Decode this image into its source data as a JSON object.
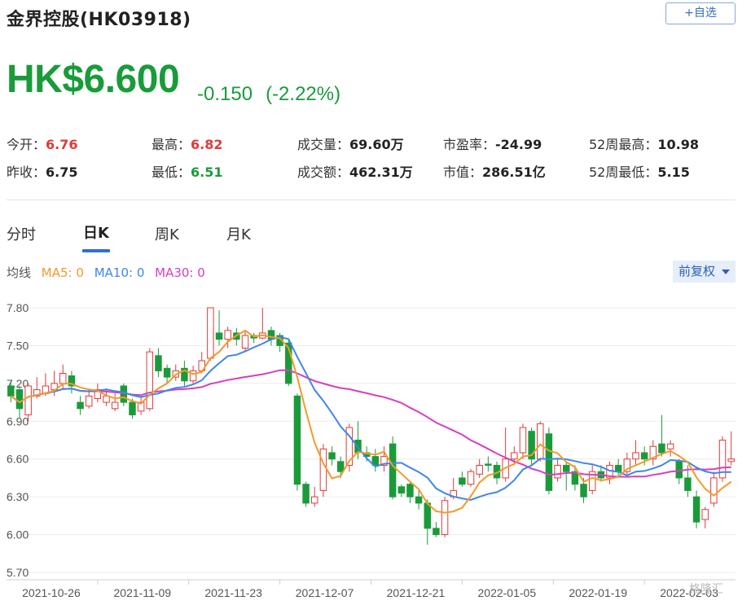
{
  "header": {
    "title": "金界控股(HK03918)",
    "watch_label": "+自选"
  },
  "quote": {
    "price": "HK$6.600",
    "change": "-0.150",
    "change_pct": "(-2.22%)"
  },
  "stats": {
    "open_label": "今开：",
    "open": "6.76",
    "high_label": "最高：",
    "high": "6.82",
    "volume_label": "成交量：",
    "volume": "69.60万",
    "pe_label": "市盈率：",
    "pe": "-24.99",
    "high52_label": "52周最高：",
    "high52": "10.98",
    "prev_label": "昨收：",
    "prev": "6.75",
    "low_label": "最低：",
    "low": "6.51",
    "turnover_label": "成交额：",
    "turnover": "462.31万",
    "mcap_label": "市值：",
    "mcap": "286.51亿",
    "low52_label": "52周最低：",
    "low52": "5.15"
  },
  "tabs": [
    "分时",
    "日K",
    "周K",
    "月K"
  ],
  "legend": {
    "label": "均线",
    "ma5": "MA5: 0",
    "ma10": "MA10: 0",
    "ma30": "MA30: 0"
  },
  "adjust_label": "前复权",
  "watermark": "格隆汇",
  "colors": {
    "up": "#e03a3a",
    "down": "#1a9b3a",
    "ma5": "#f39a2b",
    "ma10": "#3f86e8",
    "ma30": "#d63fbf"
  },
  "icons": [
    "caret-down-icon"
  ],
  "chart_data": {
    "type": "candlestick",
    "ylim": [
      5.7,
      7.8
    ],
    "yticks": [
      "7.80",
      "7.50",
      "7.20",
      "6.90",
      "6.60",
      "6.30",
      "6.00",
      "5.70"
    ],
    "xticks": [
      "2021-10-26",
      "2021-11-09",
      "2021-11-23",
      "2021-12-07",
      "2021-12-21",
      "2022-01-05",
      "2022-01-19",
      "2022-02-03"
    ],
    "candles": [
      [
        7.18,
        7.1,
        7.22,
        7.05
      ],
      [
        7.15,
        7.0,
        7.18,
        6.92
      ],
      [
        6.95,
        7.18,
        7.2,
        6.9
      ],
      [
        7.1,
        7.15,
        7.25,
        7.08
      ],
      [
        7.12,
        7.18,
        7.28,
        7.1
      ],
      [
        7.15,
        7.2,
        7.3,
        7.1
      ],
      [
        7.2,
        7.28,
        7.35,
        7.15
      ],
      [
        7.26,
        7.18,
        7.3,
        7.12
      ],
      [
        7.05,
        7.0,
        7.1,
        6.95
      ],
      [
        7.02,
        7.1,
        7.15,
        7.0
      ],
      [
        7.08,
        7.15,
        7.2,
        7.05
      ],
      [
        7.05,
        7.1,
        7.16,
        7.02
      ],
      [
        7.0,
        7.05,
        7.12,
        6.98
      ],
      [
        7.18,
        7.05,
        7.2,
        7.02
      ],
      [
        7.05,
        6.95,
        7.08,
        6.92
      ],
      [
        6.98,
        7.05,
        7.1,
        6.95
      ],
      [
        7.0,
        7.45,
        7.48,
        6.98
      ],
      [
        7.42,
        7.3,
        7.48,
        7.25
      ],
      [
        7.32,
        7.25,
        7.35,
        7.2
      ],
      [
        7.25,
        7.3,
        7.35,
        7.22
      ],
      [
        7.32,
        7.22,
        7.38,
        7.18
      ],
      [
        7.22,
        7.3,
        7.34,
        7.2
      ],
      [
        7.3,
        7.38,
        7.45,
        7.28
      ],
      [
        7.4,
        7.8,
        7.8,
        7.38
      ],
      [
        7.6,
        7.55,
        7.78,
        7.5
      ],
      [
        7.55,
        7.62,
        7.65,
        7.48
      ],
      [
        7.6,
        7.55,
        7.64,
        7.5
      ],
      [
        7.48,
        7.58,
        7.62,
        7.45
      ],
      [
        7.58,
        7.56,
        7.6,
        7.52
      ],
      [
        7.56,
        7.6,
        7.8,
        7.55
      ],
      [
        7.62,
        7.55,
        7.65,
        7.5
      ],
      [
        7.58,
        7.5,
        7.6,
        7.45
      ],
      [
        7.52,
        7.2,
        7.55,
        7.18
      ],
      [
        7.1,
        6.4,
        7.12,
        6.35
      ],
      [
        6.4,
        6.25,
        6.42,
        6.22
      ],
      [
        6.25,
        6.3,
        6.38,
        6.22
      ],
      [
        6.35,
        6.68,
        6.72,
        6.3
      ],
      [
        6.65,
        6.6,
        6.7,
        6.55
      ],
      [
        6.58,
        6.5,
        6.62,
        6.45
      ],
      [
        6.55,
        6.85,
        6.88,
        6.5
      ],
      [
        6.75,
        6.65,
        6.9,
        6.6
      ],
      [
        6.65,
        6.62,
        6.7,
        6.58
      ],
      [
        6.62,
        6.55,
        6.68,
        6.5
      ],
      [
        6.55,
        6.62,
        6.7,
        6.5
      ],
      [
        6.72,
        6.3,
        6.78,
        6.28
      ],
      [
        6.38,
        6.33,
        6.4,
        6.3
      ],
      [
        6.4,
        6.3,
        6.42,
        6.25
      ],
      [
        6.3,
        6.25,
        6.35,
        6.2
      ],
      [
        6.25,
        6.05,
        6.28,
        5.92
      ],
      [
        6.05,
        6.0,
        6.1,
        5.98
      ],
      [
        6.0,
        6.27,
        6.3,
        5.98
      ],
      [
        6.3,
        6.35,
        6.45,
        6.28
      ],
      [
        6.45,
        6.4,
        6.5,
        6.38
      ],
      [
        6.4,
        6.5,
        6.52,
        6.38
      ],
      [
        6.48,
        6.55,
        6.6,
        6.45
      ],
      [
        6.56,
        6.55,
        6.62,
        6.5
      ],
      [
        6.55,
        6.45,
        6.58,
        6.4
      ],
      [
        6.45,
        6.6,
        6.85,
        6.42
      ],
      [
        6.6,
        6.65,
        6.7,
        6.55
      ],
      [
        6.65,
        6.85,
        6.88,
        6.6
      ],
      [
        6.82,
        6.6,
        6.85,
        6.55
      ],
      [
        6.6,
        6.88,
        6.9,
        6.58
      ],
      [
        6.8,
        6.35,
        6.85,
        6.32
      ],
      [
        6.45,
        6.55,
        6.6,
        6.42
      ],
      [
        6.55,
        6.5,
        6.58,
        6.35
      ],
      [
        6.5,
        6.4,
        6.55,
        6.35
      ],
      [
        6.4,
        6.3,
        6.45,
        6.25
      ],
      [
        6.35,
        6.5,
        6.55,
        6.32
      ],
      [
        6.5,
        6.45,
        6.55,
        6.42
      ],
      [
        6.45,
        6.55,
        6.58,
        6.4
      ],
      [
        6.55,
        6.5,
        6.6,
        6.45
      ],
      [
        6.5,
        6.6,
        6.65,
        6.48
      ],
      [
        6.6,
        6.65,
        6.75,
        6.55
      ],
      [
        6.65,
        6.6,
        6.7,
        6.55
      ],
      [
        6.6,
        6.7,
        6.75,
        6.55
      ],
      [
        6.72,
        6.65,
        6.95,
        6.62
      ],
      [
        6.68,
        6.72,
        6.75,
        6.62
      ],
      [
        6.58,
        6.45,
        6.6,
        6.4
      ],
      [
        6.45,
        6.35,
        6.55,
        6.3
      ],
      [
        6.3,
        6.1,
        6.35,
        6.05
      ],
      [
        6.12,
        6.2,
        6.22,
        6.05
      ],
      [
        6.25,
        6.45,
        6.5,
        6.22
      ],
      [
        6.45,
        6.75,
        6.78,
        6.42
      ],
      [
        6.58,
        6.6,
        6.82,
        6.55
      ]
    ]
  }
}
